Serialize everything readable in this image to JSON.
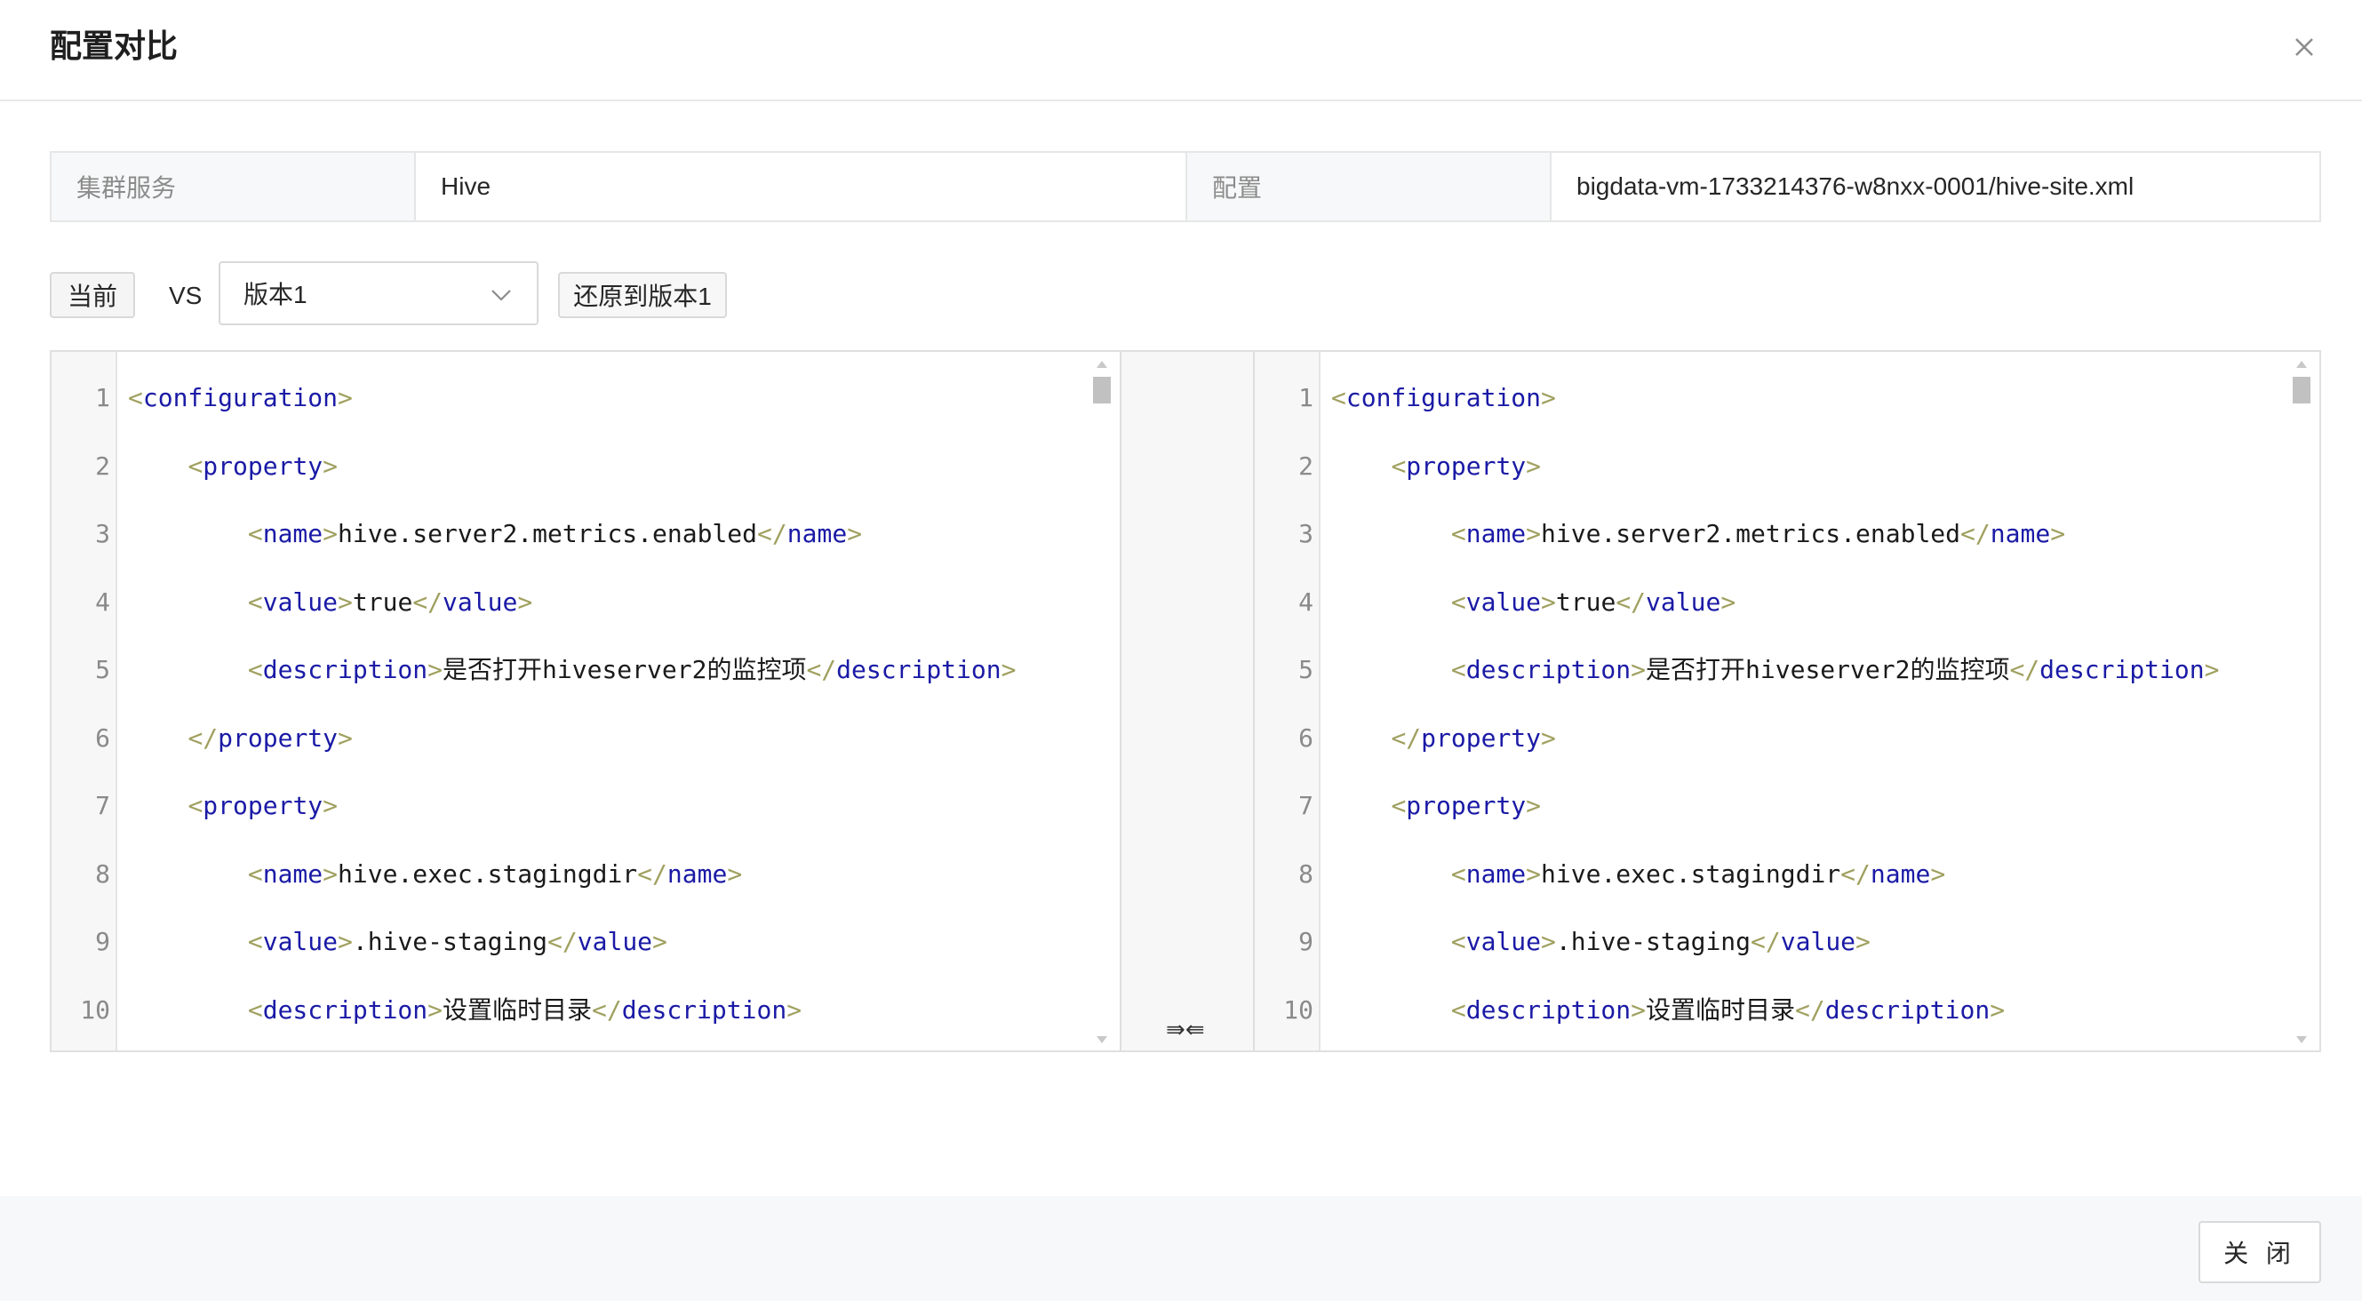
{
  "dialog": {
    "title": "配置对比",
    "close_label": "关 闭"
  },
  "info": {
    "service_label": "集群服务",
    "service_value": "Hive",
    "config_label": "配置",
    "config_value": "bigdata-vm-1733214376-w8nxx-0001/hive-site.xml"
  },
  "toolbar": {
    "current_label": "当前",
    "vs_label": "VS",
    "version_selected": "版本1",
    "restore_label": "还原到版本1"
  },
  "diff": {
    "merge_icon": "⇛⇚",
    "left_lines": [
      {
        "n": "1",
        "indent": 0,
        "tag": "configuration",
        "kind": "open"
      },
      {
        "n": "2",
        "indent": 1,
        "tag": "property",
        "kind": "open"
      },
      {
        "n": "3",
        "indent": 2,
        "tag": "name",
        "kind": "pair",
        "text": "hive.server2.metrics.enabled"
      },
      {
        "n": "4",
        "indent": 2,
        "tag": "value",
        "kind": "pair",
        "text": "true"
      },
      {
        "n": "5",
        "indent": 2,
        "tag": "description",
        "kind": "pair",
        "text": "是否打开hiveserver2的监控项"
      },
      {
        "n": "6",
        "indent": 1,
        "tag": "property",
        "kind": "close"
      },
      {
        "n": "7",
        "indent": 1,
        "tag": "property",
        "kind": "open"
      },
      {
        "n": "8",
        "indent": 2,
        "tag": "name",
        "kind": "pair",
        "text": "hive.exec.stagingdir"
      },
      {
        "n": "9",
        "indent": 2,
        "tag": "value",
        "kind": "pair",
        "text": ".hive-staging"
      },
      {
        "n": "10",
        "indent": 2,
        "tag": "description",
        "kind": "pair",
        "text": "设置临时目录"
      }
    ],
    "right_lines": [
      {
        "n": "1",
        "indent": 0,
        "tag": "configuration",
        "kind": "open"
      },
      {
        "n": "2",
        "indent": 1,
        "tag": "property",
        "kind": "open"
      },
      {
        "n": "3",
        "indent": 2,
        "tag": "name",
        "kind": "pair",
        "text": "hive.server2.metrics.enabled"
      },
      {
        "n": "4",
        "indent": 2,
        "tag": "value",
        "kind": "pair",
        "text": "true"
      },
      {
        "n": "5",
        "indent": 2,
        "tag": "description",
        "kind": "pair",
        "text": "是否打开hiveserver2的监控项"
      },
      {
        "n": "6",
        "indent": 1,
        "tag": "property",
        "kind": "close"
      },
      {
        "n": "7",
        "indent": 1,
        "tag": "property",
        "kind": "open"
      },
      {
        "n": "8",
        "indent": 2,
        "tag": "name",
        "kind": "pair",
        "text": "hive.exec.stagingdir"
      },
      {
        "n": "9",
        "indent": 2,
        "tag": "value",
        "kind": "pair",
        "text": ".hive-staging"
      },
      {
        "n": "10",
        "indent": 2,
        "tag": "description",
        "kind": "pair",
        "text": "设置临时目录"
      }
    ]
  }
}
